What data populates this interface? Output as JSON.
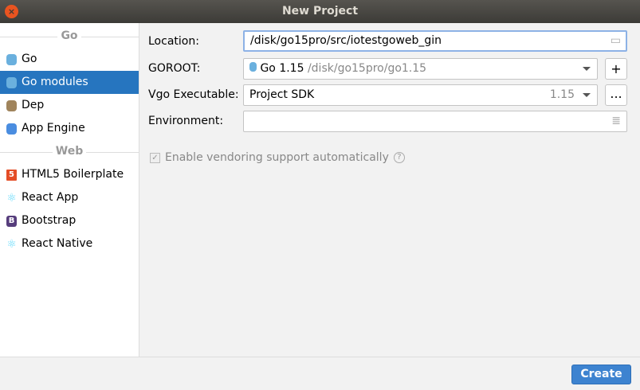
{
  "window": {
    "title": "New Project",
    "close_icon": "close-icon"
  },
  "sidebar": {
    "sections": [
      {
        "title": "Go",
        "items": [
          {
            "label": "Go",
            "icon": "gopher-icon"
          },
          {
            "label": "Go modules",
            "icon": "gopher-icon",
            "selected": true
          },
          {
            "label": "Dep",
            "icon": "dep-gopher-icon"
          },
          {
            "label": "App Engine",
            "icon": "app-engine-icon"
          }
        ]
      },
      {
        "title": "Web",
        "items": [
          {
            "label": "HTML5 Boilerplate",
            "icon": "html5-icon"
          },
          {
            "label": "React App",
            "icon": "react-icon"
          },
          {
            "label": "Bootstrap",
            "icon": "bootstrap-icon"
          },
          {
            "label": "React Native",
            "icon": "react-icon"
          }
        ]
      }
    ]
  },
  "form": {
    "location_label": "Location:",
    "location_value": "/disk/go15pro/src/iotestgoweb_gin",
    "goroot_label": "GOROOT:",
    "goroot_name": "Go 1.15",
    "goroot_path": "/disk/go15pro/go1.15",
    "goroot_add": "+",
    "vgo_label": "Vgo Executable:",
    "vgo_value": "Project SDK",
    "vgo_version": "1.15",
    "vgo_more": "...",
    "env_label": "Environment:",
    "env_value": "",
    "vendoring_label": "Enable vendoring support automatically",
    "vendoring_checked": true,
    "help": "?"
  },
  "footer": {
    "create_label": "Create"
  },
  "colors": {
    "accent": "#2675bf",
    "button": "#3d83d0"
  }
}
